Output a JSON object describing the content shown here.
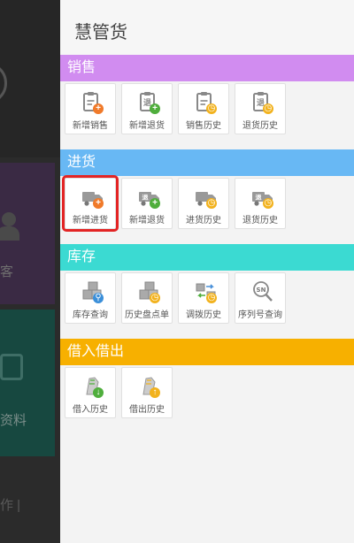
{
  "background": {
    "item1": "客",
    "item2": "资料",
    "item3": "作 |"
  },
  "drawer": {
    "title": "慧管货"
  },
  "sections": [
    {
      "header": "销售",
      "color": "#d18cf0",
      "tiles": [
        {
          "label": "新增销售",
          "icon": "clipboard-add-icon"
        },
        {
          "label": "新增退货",
          "icon": "return-add-icon"
        },
        {
          "label": "销售历史",
          "icon": "clipboard-history-icon"
        },
        {
          "label": "退货历史",
          "icon": "return-history-icon"
        }
      ]
    },
    {
      "header": "进货",
      "color": "#68b8f4",
      "tiles": [
        {
          "label": "新增进货",
          "icon": "truck-add-icon"
        },
        {
          "label": "新增退货",
          "icon": "truck-return-add-icon"
        },
        {
          "label": "进货历史",
          "icon": "truck-history-icon"
        },
        {
          "label": "退货历史",
          "icon": "truck-return-history-icon"
        }
      ]
    },
    {
      "header": "库存",
      "color": "#3bdad2",
      "tiles": [
        {
          "label": "库存查询",
          "icon": "boxes-search-icon"
        },
        {
          "label": "历史盘点单",
          "icon": "boxes-history-icon"
        },
        {
          "label": "调拨历史",
          "icon": "transfer-history-icon"
        },
        {
          "label": "序列号查询",
          "icon": "serial-search-icon"
        }
      ]
    },
    {
      "header": "借入借出",
      "color": "#f7b000",
      "tiles": [
        {
          "label": "借入历史",
          "icon": "borrow-in-icon"
        },
        {
          "label": "借出历史",
          "icon": "borrow-out-icon"
        }
      ]
    }
  ]
}
